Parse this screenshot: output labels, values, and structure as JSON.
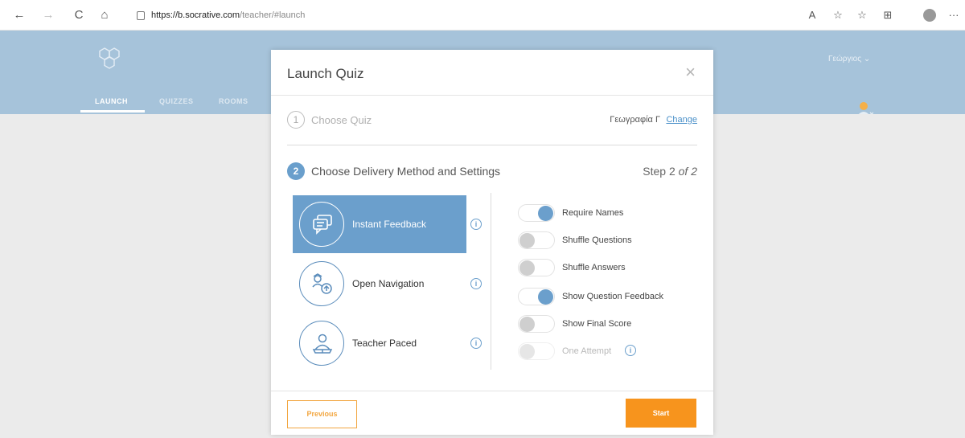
{
  "browser": {
    "back_icon": "←",
    "forward_icon": "→",
    "refresh_icon": "C",
    "home_icon": "⌂",
    "url_host": "https://b.socrative.com",
    "url_path": "/teacher/#launch",
    "read_aloud_icon": "A",
    "favorite_icon": "☆",
    "favorites_icon": "☆",
    "collections_icon": "⊞",
    "more_icon": "···"
  },
  "header": {
    "tabs": [
      "LAUNCH",
      "QUIZZES",
      "ROOMS"
    ],
    "user_label": "Γεώργιος"
  },
  "modal": {
    "title": "Launch Quiz",
    "close_icon": "×",
    "step1": {
      "number": "1",
      "label": "Choose Quiz",
      "quiz_name": "Γεωγραφία Γ",
      "change_label": "Change"
    },
    "step2": {
      "number": "2",
      "label": "Choose Delivery Method and Settings",
      "step_prefix": "Step 2",
      "step_suffix": "of 2"
    },
    "methods": [
      {
        "label": "Instant Feedback",
        "icon": "chat-bubbles-icon",
        "selected": true
      },
      {
        "label": "Open Navigation",
        "icon": "navigation-icon",
        "selected": false
      },
      {
        "label": "Teacher Paced",
        "icon": "teacher-icon",
        "selected": false
      }
    ],
    "info_icon": "i",
    "settings": [
      {
        "label": "Require Names",
        "on": true,
        "disabled": false
      },
      {
        "label": "Shuffle Questions",
        "on": false,
        "disabled": false
      },
      {
        "label": "Shuffle Answers",
        "on": false,
        "disabled": false
      },
      {
        "label": "Show Question Feedback",
        "on": true,
        "disabled": false
      },
      {
        "label": "Show Final Score",
        "on": false,
        "disabled": false
      },
      {
        "label": "One Attempt",
        "on": false,
        "disabled": true
      }
    ],
    "previous_label": "Previous",
    "start_label": "Start"
  },
  "colors": {
    "accent_blue": "#6b9fcc",
    "accent_orange": "#f7941d",
    "header_bg": "#a6c3da"
  }
}
